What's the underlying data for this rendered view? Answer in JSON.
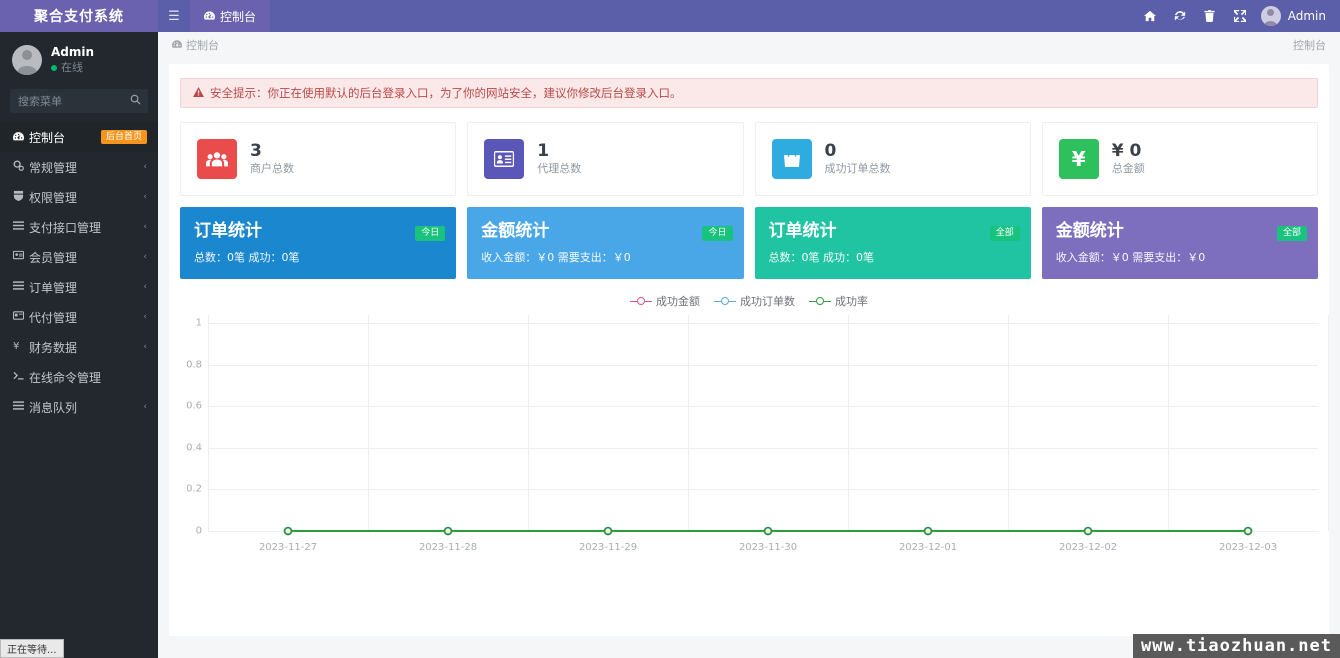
{
  "header": {
    "logo_title": "聚合支付系统",
    "hamburger_icon": "hamburger-icon",
    "tabs": [
      {
        "label": "控制台",
        "icon": "dashboard-icon",
        "active": true
      }
    ],
    "right_icons": [
      {
        "name": "home-icon",
        "glyph": "⌂"
      },
      {
        "name": "refresh-icon",
        "glyph": "⟳"
      },
      {
        "name": "trash-icon",
        "glyph": "Ὕ1"
      },
      {
        "name": "fullscreen-icon",
        "glyph": "✖"
      }
    ],
    "admin_label": "Admin"
  },
  "sidebar": {
    "user": {
      "name": "Admin",
      "status": "在线",
      "status_color": "#00b96b"
    },
    "search": {
      "placeholder": "搜索菜单",
      "icon": "search-icon"
    },
    "items": [
      {
        "label": "控制台",
        "icon": "dashboard-icon",
        "badge": "后台首页",
        "arrow": "",
        "active": true
      },
      {
        "label": "常规管理",
        "icon": "cogs-icon",
        "badge": "",
        "arrow": "‹",
        "active": false
      },
      {
        "label": "权限管理",
        "icon": "users-icon",
        "badge": "",
        "arrow": "‹",
        "active": false
      },
      {
        "label": "支付接口管理",
        "icon": "list-icon",
        "badge": "",
        "arrow": "‹",
        "active": false
      },
      {
        "label": "会员管理",
        "icon": "user-card-icon",
        "badge": "",
        "arrow": "‹",
        "active": false
      },
      {
        "label": "订单管理",
        "icon": "list-icon",
        "badge": "",
        "arrow": "‹",
        "active": false
      },
      {
        "label": "代付管理",
        "icon": "card-icon",
        "badge": "",
        "arrow": "‹",
        "active": false
      },
      {
        "label": "财务数据",
        "icon": "yen-icon",
        "badge": "",
        "arrow": "‹",
        "active": false
      },
      {
        "label": "在线命令管理",
        "icon": "terminal-icon",
        "badge": "",
        "arrow": "",
        "active": false
      },
      {
        "label": "消息队列",
        "icon": "list-icon",
        "badge": "",
        "arrow": "‹",
        "active": false
      }
    ]
  },
  "breadcrumb": {
    "icon": "dashboard-icon",
    "label": "控制台",
    "right_label": "控制台"
  },
  "alert": {
    "icon": "warning-icon",
    "text": "安全提示：你正在使用默认的后台登录入口，为了你的网站安全，建议你修改后台登录入口。"
  },
  "stats": [
    {
      "value": "3",
      "label": "商户总数",
      "icon": "group-icon",
      "color": "#ea4b4b"
    },
    {
      "value": "1",
      "label": "代理总数",
      "icon": "id-card-icon",
      "color": "#5b57b9"
    },
    {
      "value": "0",
      "label": "成功订单总数",
      "icon": "bag-icon",
      "color": "#2eabdf"
    },
    {
      "value": "¥ 0",
      "label": "总金额",
      "icon": "yen-icon",
      "color": "#2ec05c"
    }
  ],
  "tiles": [
    {
      "title": "订单统计",
      "sub": "总数：0笔 成功：0笔",
      "pill": "今日",
      "color": "#1a87ce"
    },
    {
      "title": "金额统计",
      "sub": "收入金额：￥0 需要支出：￥0",
      "pill": "今日",
      "color": "#49a7e8"
    },
    {
      "title": "订单统计",
      "sub": "总数：0笔 成功：0笔",
      "pill": "全部",
      "color": "#21c4a2"
    },
    {
      "title": "金额统计",
      "sub": "收入金额：￥0 需要支出：￥0",
      "pill": "全部",
      "color": "#7d6fbe"
    }
  ],
  "chart_data": {
    "type": "line",
    "title": "",
    "xlabel": "",
    "ylabel": "",
    "grid": true,
    "legend_position": "top-center",
    "x": [
      "2023-11-27",
      "2023-11-28",
      "2023-11-29",
      "2023-11-30",
      "2023-12-01",
      "2023-12-02",
      "2023-12-03"
    ],
    "yticks": [
      "0",
      "0.2",
      "0.4",
      "0.6",
      "0.8",
      "1"
    ],
    "ylim": [
      0,
      1
    ],
    "series": [
      {
        "name": "成功金额",
        "color": "#e2538a",
        "values": [
          0,
          0,
          0,
          0,
          0,
          0,
          0
        ]
      },
      {
        "name": "成功订单数",
        "color": "#5aa7e8",
        "values": [
          0,
          0,
          0,
          0,
          0,
          0,
          0
        ]
      },
      {
        "name": "成功率",
        "color": "#2a9b3f",
        "values": [
          0,
          0,
          0,
          0,
          0,
          0,
          0
        ]
      }
    ]
  },
  "watermark": "www.tiaozhuan.net",
  "statusbar": "正在等待..."
}
